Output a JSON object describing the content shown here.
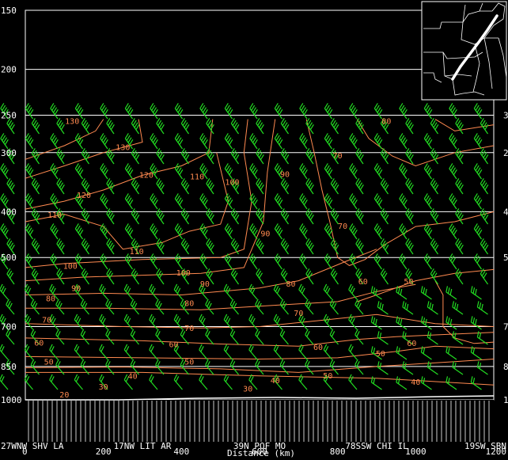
{
  "chart_data": {
    "type": "cross-section",
    "y_axis": {
      "ticks": [
        "150",
        "200",
        "250",
        "300",
        "400",
        "500",
        "700",
        "850",
        "1000"
      ],
      "values": [
        150,
        200,
        250,
        300,
        400,
        500,
        700,
        850,
        1000
      ],
      "scale": "log-pressure",
      "ylim": [
        150,
        1000
      ]
    },
    "y_axis_right_ticks": [
      "2",
      "3",
      "4",
      "5",
      "7",
      "8",
      "1"
    ],
    "x_axis": {
      "label": "Distance (km)",
      "ticks": [
        "0",
        "200",
        "400",
        "600",
        "800",
        "1000",
        "1200"
      ],
      "values": [
        0,
        200,
        400,
        600,
        800,
        1000,
        1200
      ],
      "xlim": [
        0,
        1200
      ]
    },
    "stations": [
      {
        "label": "27WNW SHV LA",
        "x": 0
      },
      {
        "label": "17NW LIT AR",
        "x": 300
      },
      {
        "label": "39N POF MO",
        "x": 600
      },
      {
        "label": "78SSW CHI IL",
        "x": 900
      },
      {
        "label": "19SW SBN",
        "x": 1200
      }
    ],
    "isotach_labels": [
      {
        "text": "130",
        "x": 120,
        "p": 258
      },
      {
        "text": "130",
        "x": 250,
        "p": 293
      },
      {
        "text": "120",
        "x": 310,
        "p": 335
      },
      {
        "text": "120",
        "x": 150,
        "p": 370
      },
      {
        "text": "110",
        "x": 440,
        "p": 338
      },
      {
        "text": "100",
        "x": 530,
        "p": 347
      },
      {
        "text": "90",
        "x": 665,
        "p": 334
      },
      {
        "text": "70",
        "x": 800,
        "p": 305
      },
      {
        "text": "80",
        "x": 925,
        "p": 258
      },
      {
        "text": "110",
        "x": 75,
        "p": 407
      },
      {
        "text": "110",
        "x": 285,
        "p": 486
      },
      {
        "text": "90",
        "x": 615,
        "p": 446
      },
      {
        "text": "70",
        "x": 813,
        "p": 430
      },
      {
        "text": "100",
        "x": 115,
        "p": 522
      },
      {
        "text": "100",
        "x": 405,
        "p": 540
      },
      {
        "text": "90",
        "x": 130,
        "p": 582
      },
      {
        "text": "90",
        "x": 460,
        "p": 570
      },
      {
        "text": "80",
        "x": 680,
        "p": 569
      },
      {
        "text": "60",
        "x": 865,
        "p": 563
      },
      {
        "text": "50",
        "x": 982,
        "p": 563
      },
      {
        "text": "80",
        "x": 65,
        "p": 612
      },
      {
        "text": "80",
        "x": 420,
        "p": 626
      },
      {
        "text": "70",
        "x": 700,
        "p": 657
      },
      {
        "text": "70",
        "x": 55,
        "p": 679
      },
      {
        "text": "70",
        "x": 420,
        "p": 707
      },
      {
        "text": "60",
        "x": 35,
        "p": 759
      },
      {
        "text": "60",
        "x": 380,
        "p": 765
      },
      {
        "text": "60",
        "x": 750,
        "p": 775
      },
      {
        "text": "60",
        "x": 990,
        "p": 760
      },
      {
        "text": "50",
        "x": 910,
        "p": 800
      },
      {
        "text": "50",
        "x": 60,
        "p": 832
      },
      {
        "text": "50",
        "x": 420,
        "p": 832
      },
      {
        "text": "40",
        "x": 275,
        "p": 892
      },
      {
        "text": "50",
        "x": 775,
        "p": 890
      },
      {
        "text": "40",
        "x": 640,
        "p": 912
      },
      {
        "text": "40",
        "x": 1000,
        "p": 918
      },
      {
        "text": "30",
        "x": 200,
        "p": 940
      },
      {
        "text": "30",
        "x": 570,
        "p": 950
      },
      {
        "text": "20",
        "x": 100,
        "p": 977
      }
    ],
    "grid": true,
    "colors": {
      "background": "#000000",
      "isotach": "#ff8a50",
      "barb": "#22dd22",
      "axis": "#ffffff"
    }
  },
  "inset_map": {
    "description_icon": "map-inset-icon"
  }
}
